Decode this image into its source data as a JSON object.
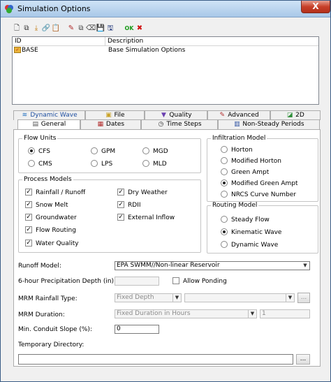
{
  "window": {
    "title": "Simulation Options",
    "close_symbol": "X"
  },
  "toolbar": {
    "icons": [
      "new-icon",
      "copy-icon",
      "import-icon",
      "link-icon",
      "paste-icon",
      "edit-icon",
      "duplicate-icon",
      "erase-icon",
      "save-icon",
      "save-as-icon",
      "ok-icon",
      "cancel-icon"
    ],
    "glyphs": [
      "🗋",
      "⧉",
      "⤓",
      "🔗",
      "📋",
      "✎",
      "⧉",
      "⌫",
      "💾",
      "🖫",
      "OK",
      "✖"
    ]
  },
  "list": {
    "columns": [
      "ID",
      "Description"
    ],
    "rows": [
      {
        "id": "BASE",
        "description": "Base Simulation Options"
      }
    ]
  },
  "tabs_row1": [
    {
      "label": "Dynamic Wave",
      "icon": "wave-icon",
      "glyph": "≋"
    },
    {
      "label": "File",
      "icon": "file-icon",
      "glyph": "▣"
    },
    {
      "label": "Quality",
      "icon": "quality-icon",
      "glyph": "▼"
    },
    {
      "label": "Advanced",
      "icon": "advanced-icon",
      "glyph": "✎"
    },
    {
      "label": "2D",
      "icon": "two-d-icon",
      "glyph": "◪"
    }
  ],
  "tabs_row2": [
    {
      "label": "General",
      "icon": "general-icon",
      "glyph": "▤"
    },
    {
      "label": "Dates",
      "icon": "dates-icon",
      "glyph": "▦"
    },
    {
      "label": "Time Steps",
      "icon": "clock-icon",
      "glyph": "◷"
    },
    {
      "label": "Non-Steady Periods",
      "icon": "periods-icon",
      "glyph": "▥"
    }
  ],
  "flow_units": {
    "legend": "Flow Units",
    "options": [
      "CFS",
      "GPM",
      "MGD",
      "CMS",
      "LPS",
      "MLD"
    ],
    "selected": "CFS"
  },
  "process_models": {
    "legend": "Process Models",
    "items": [
      {
        "label": "Rainfall / Runoff",
        "checked": true
      },
      {
        "label": "Dry Weather",
        "checked": true
      },
      {
        "label": "Snow Melt",
        "checked": true
      },
      {
        "label": "RDII",
        "checked": true
      },
      {
        "label": "Groundwater",
        "checked": true
      },
      {
        "label": "External Inflow",
        "checked": true
      },
      {
        "label": "Flow Routing",
        "checked": true
      },
      {
        "label": "Water Quality",
        "checked": true
      }
    ]
  },
  "infiltration": {
    "legend": "Infiltration Model",
    "options": [
      "Horton",
      "Modified Horton",
      "Green Ampt",
      "Modified Green Ampt",
      "NRCS Curve Number"
    ],
    "selected": "Modified Green Ampt"
  },
  "routing": {
    "legend": "Routing Model",
    "options": [
      "Steady Flow",
      "Kinematic Wave",
      "Dynamic Wave"
    ],
    "selected": "Kinematic Wave"
  },
  "form": {
    "runoff_label": "Runoff Model:",
    "runoff_value": "EPA SWMM//Non-linear Reservoir",
    "precip_label": "6-hour Precipitation Depth (in):",
    "precip_value": "",
    "ponding_label": "Allow Ponding",
    "ponding_checked": false,
    "mrm_rain_label": "MRM Rainfall Type:",
    "mrm_rain_value": "Fixed Depth",
    "mrm_rain_value2": "",
    "mrm_dur_label": "MRM Duration:",
    "mrm_dur_value": "Fixed Duration in Hours",
    "mrm_dur_number": "1",
    "slope_label": "Min. Conduit Slope (%):",
    "slope_value": "0",
    "temp_label": "Temporary Directory:",
    "temp_value": "",
    "browse_label": "..."
  }
}
